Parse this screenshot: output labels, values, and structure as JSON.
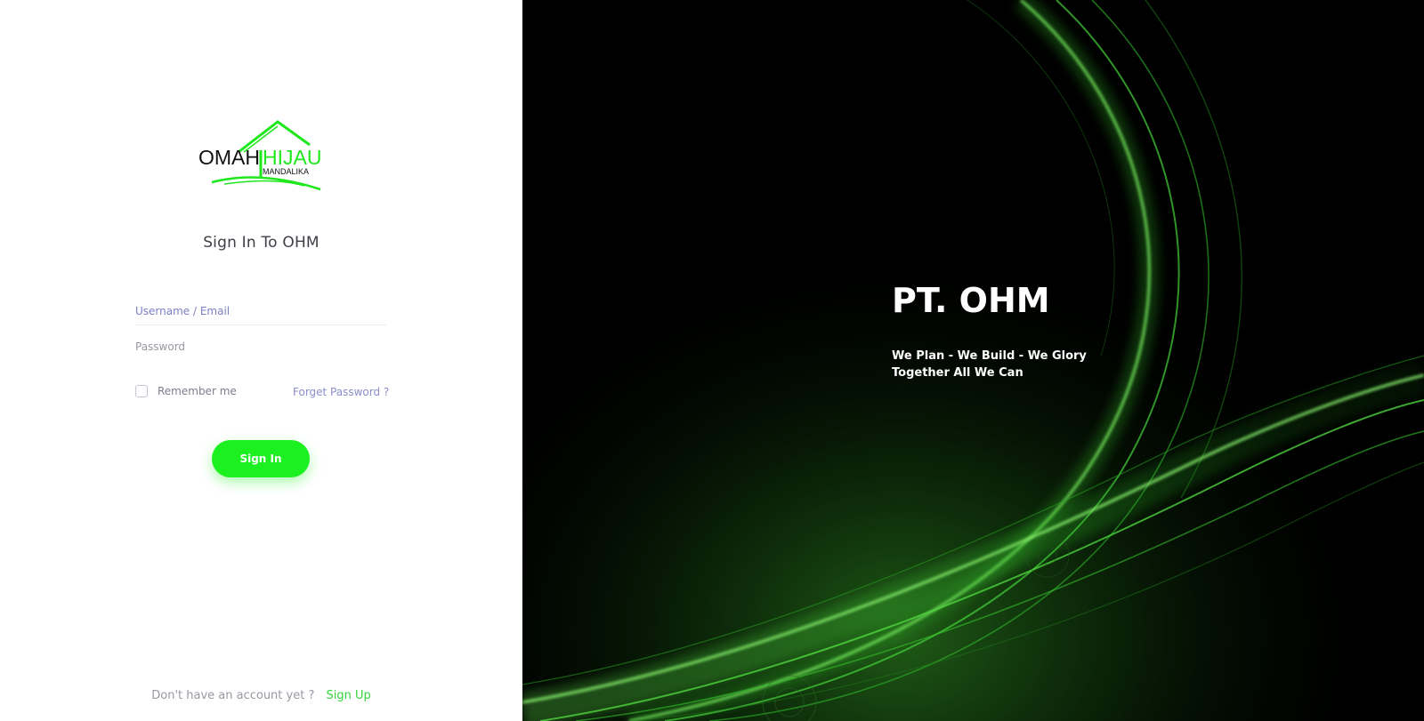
{
  "login": {
    "logo": {
      "word1": "OMAH",
      "word2": "HIJAU",
      "sub": "MANDALIKA"
    },
    "title": "Sign In To OHM",
    "username_placeholder": "Username / Email",
    "password_placeholder": "Password",
    "remember_label": "Remember me",
    "forgot_label": "Forget Password ?",
    "signin_label": "Sign In",
    "signup_prompt": "Don't have an account yet ?",
    "signup_label": "Sign Up"
  },
  "hero": {
    "title": "PT. OHM",
    "tagline_line1": "We Plan - We Build - We Glory",
    "tagline_line2": "Together All We Can"
  },
  "colors": {
    "accent_green": "#1cf020",
    "link_purple": "#8a8dc9",
    "signup_green": "#34d33a",
    "hero_bg": "#000000"
  }
}
